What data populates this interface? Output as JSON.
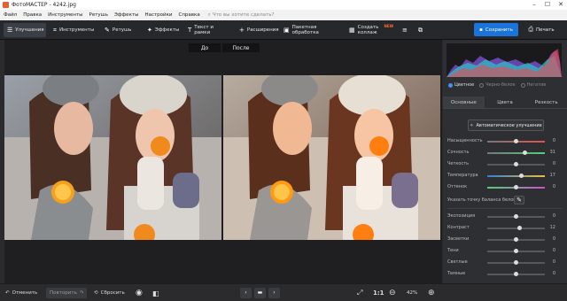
{
  "window": {
    "title": "ФотоМАСТЕР - 4242.jpg"
  },
  "menu": {
    "items": [
      "Файл",
      "Правка",
      "Инструменты",
      "Ретушь",
      "Эффекты",
      "Настройки",
      "Справка"
    ],
    "search_placeholder": "Что вы хотите сделать?"
  },
  "toolbar": {
    "tabs": [
      {
        "label": "Улучшения",
        "icon": "sliders-icon"
      },
      {
        "label": "Инструменты",
        "icon": "crop-icon"
      },
      {
        "label": "Ретушь",
        "icon": "brush-icon"
      },
      {
        "label": "Эффекты",
        "icon": "effects-icon"
      },
      {
        "label": "Текст и рамки",
        "icon": "text-icon"
      },
      {
        "label": "Расширения",
        "icon": "plus-icon"
      },
      {
        "label": "Пакетная обработка",
        "icon": "batch-icon"
      },
      {
        "label": "Создать коллаж",
        "icon": "collage-icon",
        "badge": "NEW"
      }
    ],
    "save_label": "Сохранить",
    "print_label": "Печать"
  },
  "canvas": {
    "before_label": "До",
    "after_label": "После"
  },
  "panel": {
    "color_modes": [
      "Цветное",
      "Черно-белое",
      "Негатив"
    ],
    "tabs": [
      "Основные",
      "Цвета",
      "Резкость"
    ],
    "auto_button": "Автоматическое улучшение",
    "sliders_top": [
      {
        "label": "Насыщенность",
        "value": "0"
      },
      {
        "label": "Сочность",
        "value": "31"
      },
      {
        "label": "Четкость",
        "value": "0"
      },
      {
        "label": "Температура",
        "value": "17"
      },
      {
        "label": "Оттенок",
        "value": "0"
      }
    ],
    "white_balance": "Указать точку баланса белого",
    "sliders_bottom": [
      {
        "label": "Экспозиция",
        "value": "0"
      },
      {
        "label": "Контраст",
        "value": "12"
      },
      {
        "label": "Засветки",
        "value": "0"
      },
      {
        "label": "Тени",
        "value": "0"
      },
      {
        "label": "Светлые",
        "value": "0"
      },
      {
        "label": "Темные",
        "value": "0"
      }
    ]
  },
  "bottombar": {
    "undo": "Отменить",
    "redo": "Повторить",
    "reset": "Сбросить",
    "ratio": "1:1",
    "zoom": "42%"
  },
  "colors": {
    "accent": "#1a74d9",
    "badge": "#ff6b2c"
  }
}
